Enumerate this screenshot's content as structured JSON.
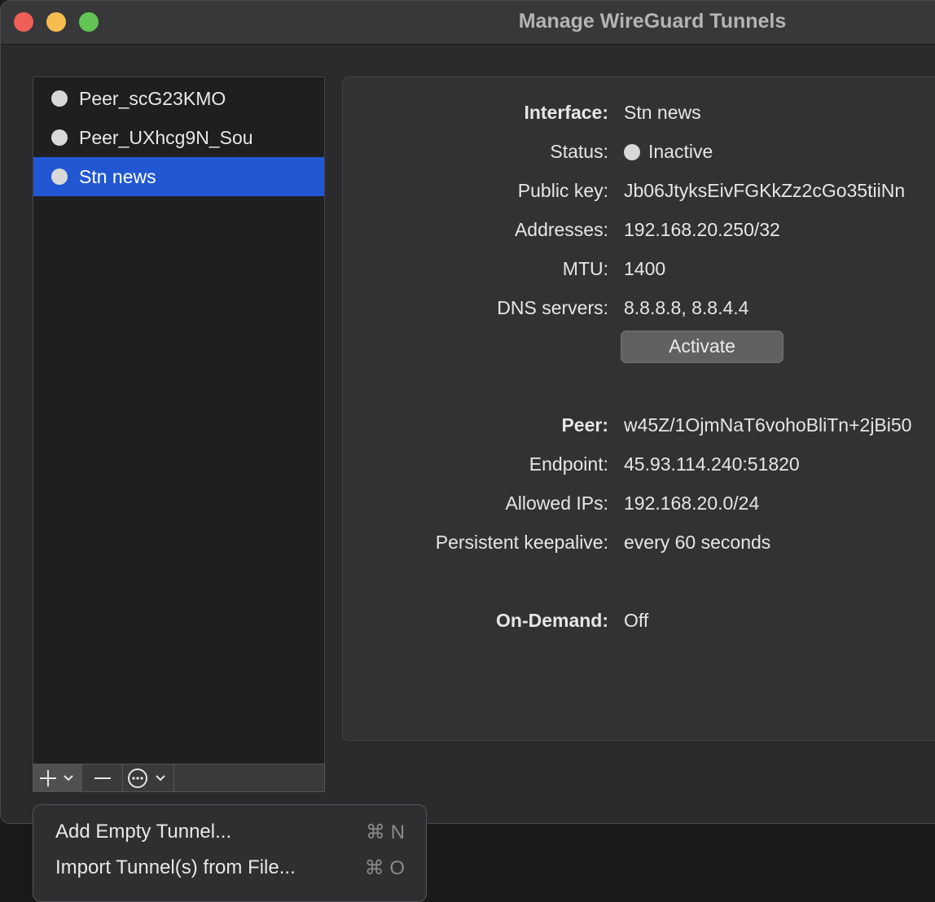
{
  "window": {
    "title": "Manage WireGuard Tunnels"
  },
  "tunnels": [
    {
      "name": "Peer_scG23KMO",
      "selected": false
    },
    {
      "name": "Peer_UXhcg9N_Sou",
      "selected": false
    },
    {
      "name": "Stn news",
      "selected": true
    }
  ],
  "toolbar": {
    "add_icon": "plus-icon",
    "remove_icon": "minus-icon",
    "action_icon": "ellipsis-circle-icon"
  },
  "interface": {
    "label": "Interface:",
    "value": "Stn news",
    "status_label": "Status:",
    "status_value": "Inactive",
    "public_key_label": "Public key:",
    "public_key_value": "Jb06JtyksEivFGKkZz2cGo35tiiNn",
    "addresses_label": "Addresses:",
    "addresses_value": "192.168.20.250/32",
    "mtu_label": "MTU:",
    "mtu_value": "1400",
    "dns_label": "DNS servers:",
    "dns_value": "8.8.8.8, 8.8.4.4",
    "activate_label": "Activate"
  },
  "peer": {
    "label": "Peer:",
    "value": "w45Z/1OjmNaT6vohoBliTn+2jBi50",
    "endpoint_label": "Endpoint:",
    "endpoint_value": "45.93.114.240:51820",
    "allowed_ips_label": "Allowed IPs:",
    "allowed_ips_value": "192.168.20.0/24",
    "keepalive_label": "Persistent keepalive:",
    "keepalive_value": "every 60 seconds"
  },
  "on_demand": {
    "label": "On-Demand:",
    "value": "Off"
  },
  "menu": {
    "items": [
      {
        "label": "Add Empty Tunnel...",
        "shortcut": "⌘ N"
      },
      {
        "label": "Import Tunnel(s) from File...",
        "shortcut": "⌘ O"
      }
    ]
  },
  "colors": {
    "selection": "#2157d3",
    "close": "#ee5f57",
    "minimize": "#f5bd4f",
    "zoom": "#61c454"
  }
}
